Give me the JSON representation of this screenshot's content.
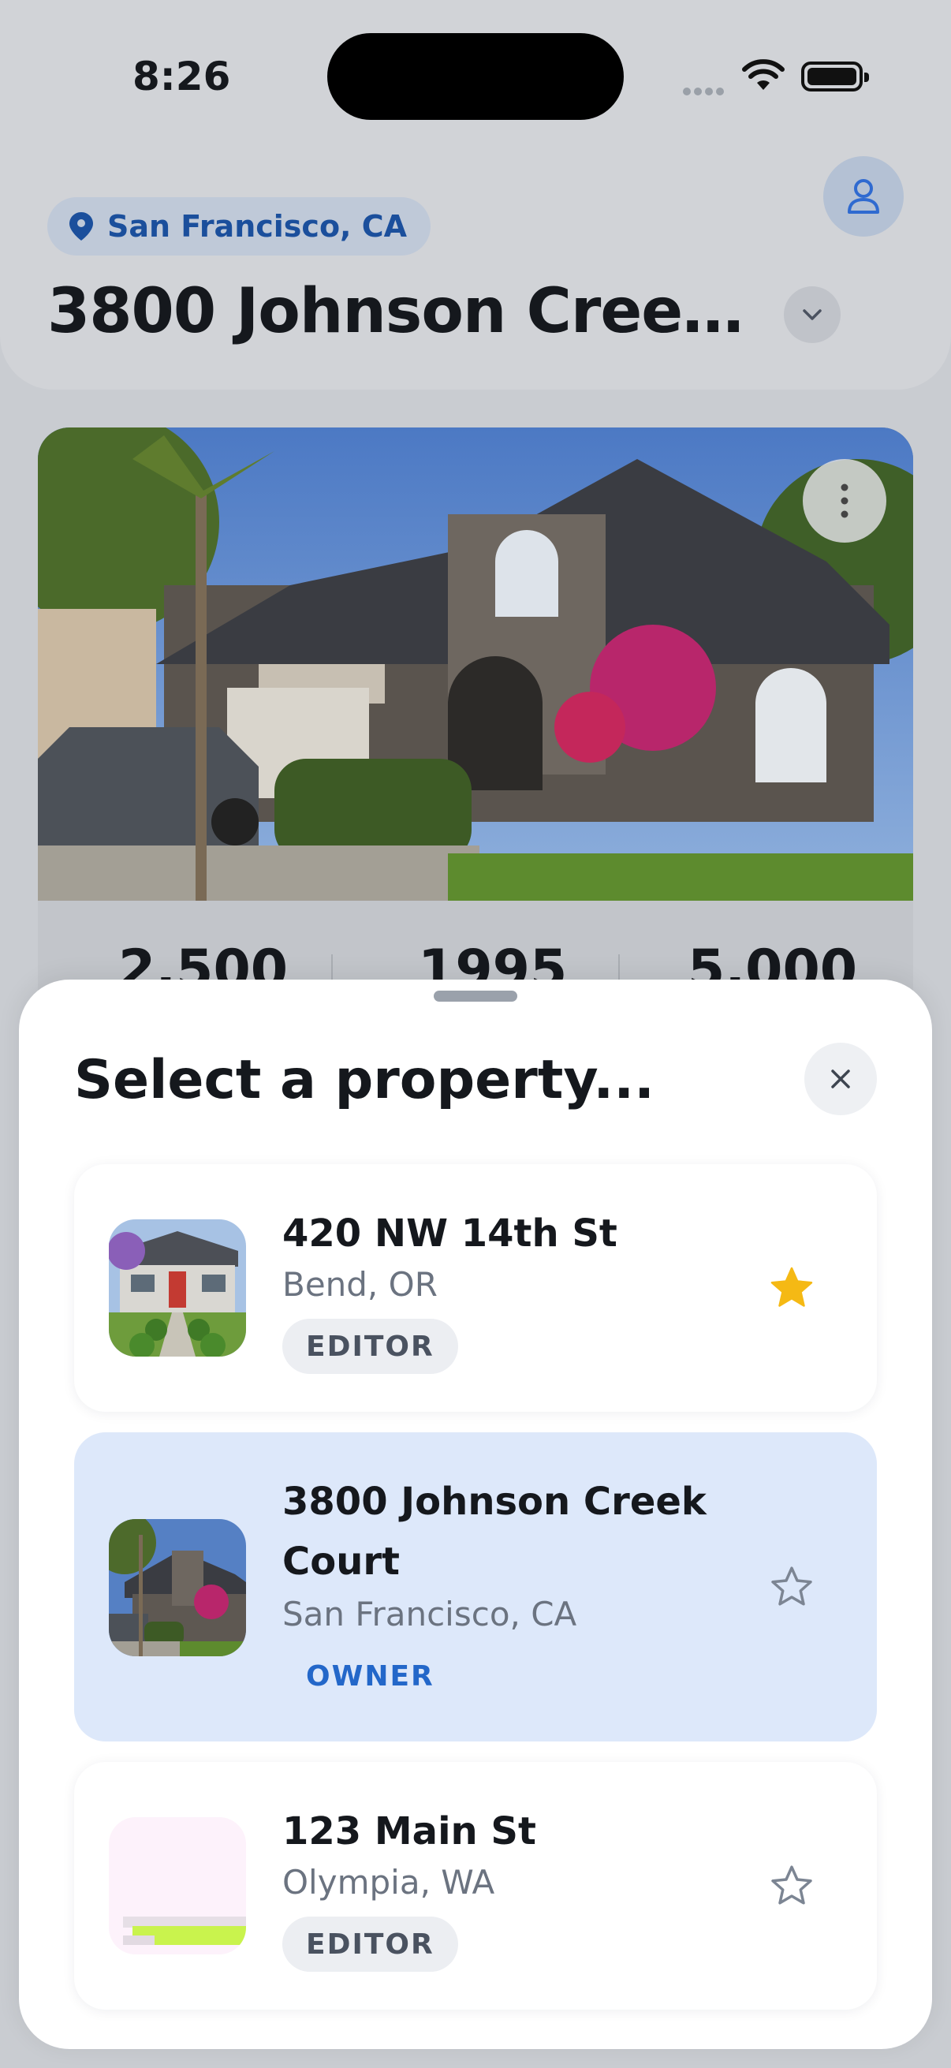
{
  "status_bar": {
    "time": "8:26"
  },
  "header": {
    "location": "San Francisco, CA",
    "property_title": "3800 Johnson Creek..."
  },
  "stats": {
    "sqft": "2,500",
    "year": "1995",
    "lot": "5,000"
  },
  "sheet": {
    "title": "Select a property...",
    "properties": [
      {
        "street": "420 NW 14th St",
        "city": "Bend, OR",
        "role": "EDITOR",
        "favorite": true,
        "selected": false
      },
      {
        "street": "3800 Johnson Creek Court",
        "street_line1": "3800 Johnson Creek",
        "street_line2": "Court",
        "city": "San Francisco, CA",
        "role": "OWNER",
        "favorite": false,
        "selected": true
      },
      {
        "street": "123 Main St",
        "city": "Olympia, WA",
        "role": "EDITOR",
        "favorite": false,
        "selected": false
      }
    ]
  },
  "colors": {
    "accent": "#2367c9",
    "selected_row": "#dde8fa",
    "star": "#f5b914"
  },
  "icons": [
    "location-pin-icon",
    "user-icon",
    "chevron-down-icon",
    "more-vertical-icon",
    "close-icon",
    "star-filled-icon",
    "star-outline-icon",
    "wifi-icon",
    "battery-icon"
  ]
}
